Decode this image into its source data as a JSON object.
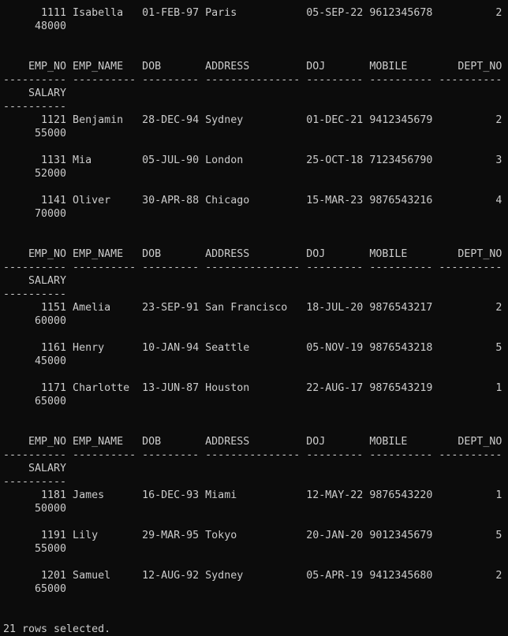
{
  "terminal": {
    "background": "#0c0c0c",
    "foreground": "#cccccc"
  },
  "columns": {
    "header": [
      "EMP_NO",
      "EMP_NAME",
      "DOB",
      "ADDRESS",
      "DOJ",
      "MOBILE",
      "DEPT_NO"
    ],
    "header2": "SALARY"
  },
  "first_row": {
    "emp_no": "1111",
    "emp_name": "Isabella",
    "dob": "01-FEB-97",
    "address": "Paris",
    "doj": "05-SEP-22",
    "mobile": "9612345678",
    "dept_no": "2",
    "salary": "48000"
  },
  "pages": [
    {
      "rows": [
        {
          "emp_no": "1121",
          "emp_name": "Benjamin",
          "dob": "28-DEC-94",
          "address": "Sydney",
          "doj": "01-DEC-21",
          "mobile": "9412345679",
          "dept_no": "2",
          "salary": "55000"
        },
        {
          "emp_no": "1131",
          "emp_name": "Mia",
          "dob": "05-JUL-90",
          "address": "London",
          "doj": "25-OCT-18",
          "mobile": "7123456790",
          "dept_no": "3",
          "salary": "52000"
        },
        {
          "emp_no": "1141",
          "emp_name": "Oliver",
          "dob": "30-APR-88",
          "address": "Chicago",
          "doj": "15-MAR-23",
          "mobile": "9876543216",
          "dept_no": "4",
          "salary": "70000"
        }
      ]
    },
    {
      "rows": [
        {
          "emp_no": "1151",
          "emp_name": "Amelia",
          "dob": "23-SEP-91",
          "address": "San Francisco",
          "doj": "18-JUL-20",
          "mobile": "9876543217",
          "dept_no": "2",
          "salary": "60000"
        },
        {
          "emp_no": "1161",
          "emp_name": "Henry",
          "dob": "10-JAN-94",
          "address": "Seattle",
          "doj": "05-NOV-19",
          "mobile": "9876543218",
          "dept_no": "5",
          "salary": "45000"
        },
        {
          "emp_no": "1171",
          "emp_name": "Charlotte",
          "dob": "13-JUN-87",
          "address": "Houston",
          "doj": "22-AUG-17",
          "mobile": "9876543219",
          "dept_no": "1",
          "salary": "65000"
        }
      ]
    },
    {
      "rows": [
        {
          "emp_no": "1181",
          "emp_name": "James",
          "dob": "16-DEC-93",
          "address": "Miami",
          "doj": "12-MAY-22",
          "mobile": "9876543220",
          "dept_no": "1",
          "salary": "50000"
        },
        {
          "emp_no": "1191",
          "emp_name": "Lily",
          "dob": "29-MAR-95",
          "address": "Tokyo",
          "doj": "20-JAN-20",
          "mobile": "9012345679",
          "dept_no": "5",
          "salary": "55000"
        },
        {
          "emp_no": "1201",
          "emp_name": "Samuel",
          "dob": "12-AUG-92",
          "address": "Sydney",
          "doj": "05-APR-19",
          "mobile": "9412345680",
          "dept_no": "2",
          "salary": "65000"
        }
      ]
    }
  ],
  "footer": "21 rows selected."
}
